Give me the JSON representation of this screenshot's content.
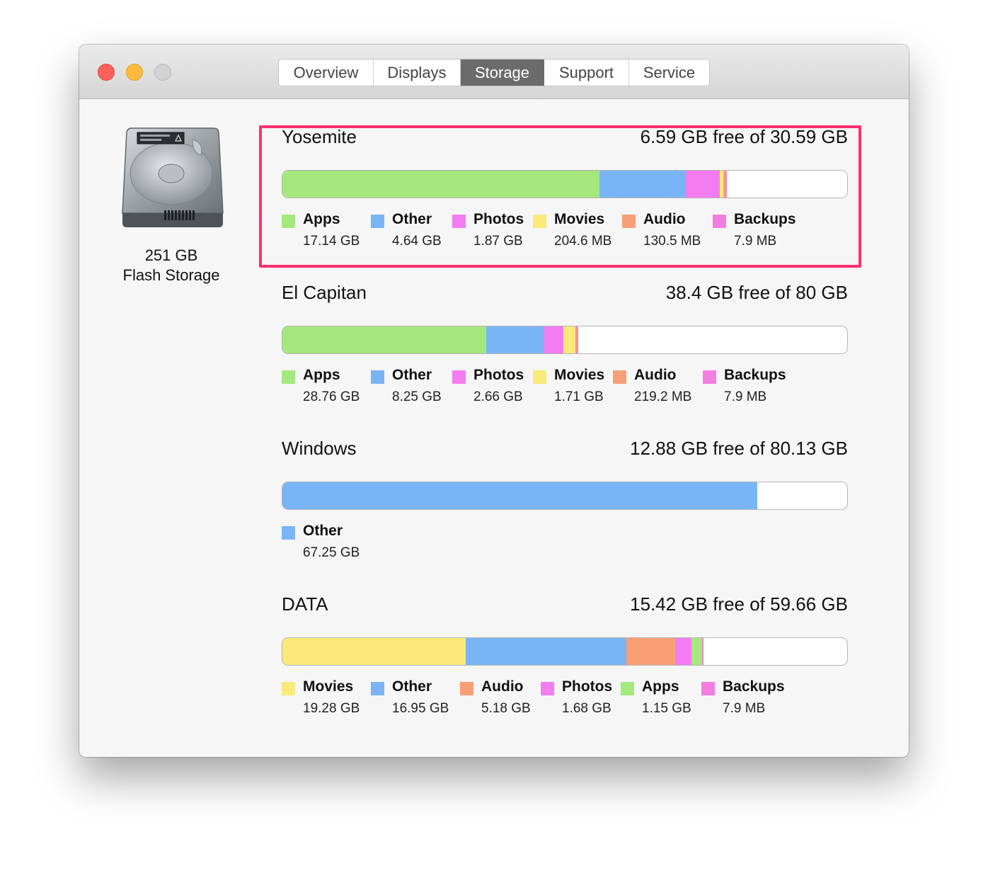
{
  "window": {
    "traffic_lights": [
      "close",
      "minimize",
      "zoom"
    ],
    "tabs": [
      {
        "label": "Overview",
        "active": false
      },
      {
        "label": "Displays",
        "active": false
      },
      {
        "label": "Storage",
        "active": true
      },
      {
        "label": "Support",
        "active": false
      },
      {
        "label": "Service",
        "active": false
      }
    ]
  },
  "disk": {
    "icon": "hard-drive-icon",
    "capacity": "251 GB",
    "type": "Flash Storage"
  },
  "colors": {
    "apps": "#a5e87d",
    "other": "#79b5f6",
    "photos": "#f37cf1",
    "movies": "#f9ea7a",
    "audio": "#f79f77",
    "backups": "#f37edf",
    "highlight": "#ff2f6e"
  },
  "volumes": [
    {
      "name": "Yosemite",
      "free": "6.59 GB free of 30.59 GB",
      "highlighted": true,
      "categories": [
        {
          "key": "apps",
          "label": "Apps",
          "value": "17.14 GB",
          "fraction": 0.5603
        },
        {
          "key": "other",
          "label": "Other",
          "value": "4.64 GB",
          "fraction": 0.1517
        },
        {
          "key": "photos",
          "label": "Photos",
          "value": "1.87 GB",
          "fraction": 0.0611
        },
        {
          "key": "movies",
          "label": "Movies",
          "value": "204.6 MB",
          "fraction": 0.0067
        },
        {
          "key": "audio",
          "label": "Audio",
          "value": "130.5 MB",
          "fraction": 0.0043
        },
        {
          "key": "backups",
          "label": "Backups",
          "value": "7.9 MB",
          "fraction": 0.0003
        }
      ]
    },
    {
      "name": "El Capitan",
      "free": "38.4 GB free of 80 GB",
      "highlighted": false,
      "categories": [
        {
          "key": "apps",
          "label": "Apps",
          "value": "28.76 GB",
          "fraction": 0.3595
        },
        {
          "key": "other",
          "label": "Other",
          "value": "8.25 GB",
          "fraction": 0.1031
        },
        {
          "key": "photos",
          "label": "Photos",
          "value": "2.66 GB",
          "fraction": 0.0333
        },
        {
          "key": "movies",
          "label": "Movies",
          "value": "1.71 GB",
          "fraction": 0.0214
        },
        {
          "key": "audio",
          "label": "Audio",
          "value": "219.2 MB",
          "fraction": 0.0027
        },
        {
          "key": "backups",
          "label": "Backups",
          "value": "7.9 MB",
          "fraction": 0.0001
        }
      ]
    },
    {
      "name": "Windows",
      "free": "12.88 GB free of 80.13 GB",
      "highlighted": false,
      "categories": [
        {
          "key": "other",
          "label": "Other",
          "value": "67.25 GB",
          "fraction": 0.8393
        }
      ]
    },
    {
      "name": "DATA",
      "free": "15.42 GB free of 59.66 GB",
      "highlighted": false,
      "categories": [
        {
          "key": "movies",
          "label": "Movies",
          "value": "19.28 GB",
          "fraction": 0.3232
        },
        {
          "key": "other",
          "label": "Other",
          "value": "16.95 GB",
          "fraction": 0.2841
        },
        {
          "key": "audio",
          "label": "Audio",
          "value": "5.18 GB",
          "fraction": 0.0868
        },
        {
          "key": "photos",
          "label": "Photos",
          "value": "1.68 GB",
          "fraction": 0.0282
        },
        {
          "key": "apps",
          "label": "Apps",
          "value": "1.15 GB",
          "fraction": 0.0193
        },
        {
          "key": "backups",
          "label": "Backups",
          "value": "7.9 MB",
          "fraction": 0.0001
        }
      ]
    }
  ]
}
